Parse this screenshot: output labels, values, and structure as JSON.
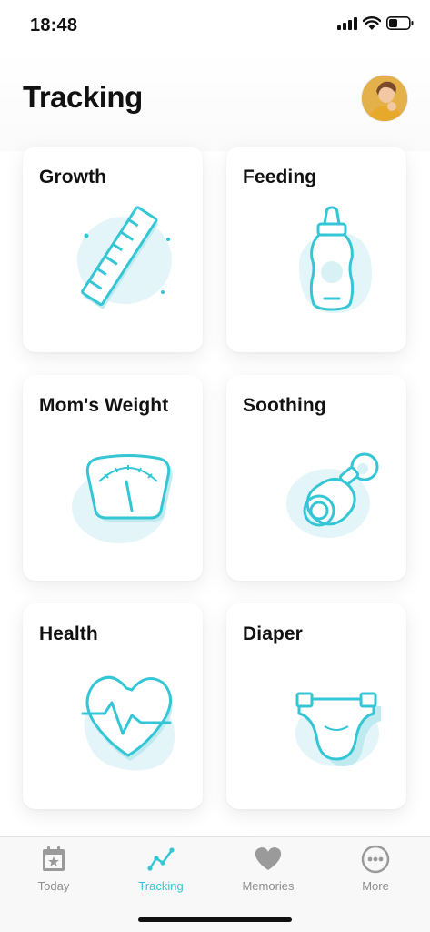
{
  "status_bar": {
    "time": "18:48"
  },
  "header": {
    "title": "Tracking"
  },
  "cards": [
    {
      "title": "Growth",
      "icon": "ruler-icon"
    },
    {
      "title": "Feeding",
      "icon": "baby-bottle-icon"
    },
    {
      "title": "Mom's Weight",
      "icon": "scale-icon"
    },
    {
      "title": "Soothing",
      "icon": "pacifier-icon"
    },
    {
      "title": "Health",
      "icon": "heart-pulse-icon"
    },
    {
      "title": "Diaper",
      "icon": "diaper-icon"
    }
  ],
  "tab_bar": {
    "tabs": [
      {
        "label": "Today",
        "icon": "calendar-star-icon",
        "active": false
      },
      {
        "label": "Tracking",
        "icon": "line-chart-icon",
        "active": true
      },
      {
        "label": "Memories",
        "icon": "heart-icon",
        "active": false
      },
      {
        "label": "More",
        "icon": "more-dots-icon",
        "active": false
      }
    ]
  },
  "colors": {
    "accent": "#35c6d6",
    "illustration_bg": "#e3f5f8",
    "inactive": "#8e8e8e"
  }
}
